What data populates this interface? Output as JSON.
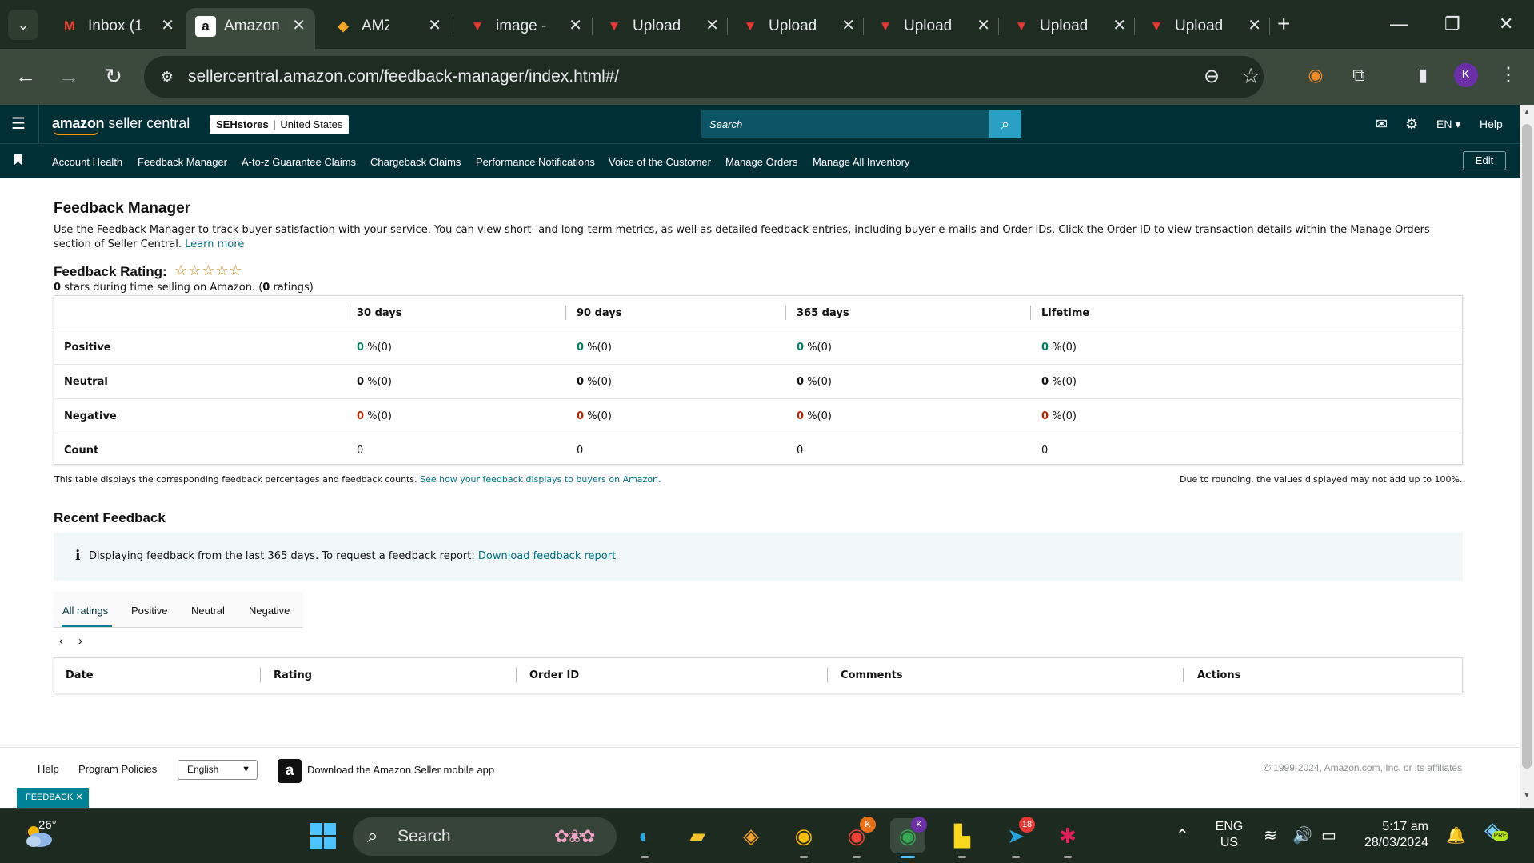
{
  "browser": {
    "tabs": [
      {
        "title": "Inbox (1",
        "icon": "gmail-icon",
        "active": false
      },
      {
        "title": "Amazon",
        "icon": "amazon-icon",
        "active": true
      },
      {
        "title": "AMZ EC",
        "icon": "amz-icon",
        "active": false
      },
      {
        "title": "image -",
        "icon": "upload-icon",
        "active": false
      },
      {
        "title": "Upload",
        "icon": "upload-icon",
        "active": false
      },
      {
        "title": "Upload",
        "icon": "upload-icon",
        "active": false
      },
      {
        "title": "Upload",
        "icon": "upload-icon",
        "active": false
      },
      {
        "title": "Upload",
        "icon": "upload-icon",
        "active": false
      },
      {
        "title": "Upload",
        "icon": "upload-icon",
        "active": false
      }
    ],
    "url": "sellercentral.amazon.com/feedback-manager/index.html#/",
    "profile_initial": "K"
  },
  "header": {
    "logo_brand": "amazon",
    "logo_text": "seller central",
    "store_name": "SEHstores",
    "marketplace": "United States",
    "search_placeholder": "Search",
    "language": "EN",
    "help": "Help"
  },
  "nav": {
    "links": [
      "Account Health",
      "Feedback Manager",
      "A-to-z Guarantee Claims",
      "Chargeback Claims",
      "Performance Notifications",
      "Voice of the Customer",
      "Manage Orders",
      "Manage All Inventory"
    ],
    "edit": "Edit"
  },
  "page": {
    "title": "Feedback Manager",
    "description": "Use the Feedback Manager to track buyer satisfaction with your service. You can view short- and long-term metrics, as well as detailed feedback entries, including buyer e-mails and Order IDs. Click the Order ID to view transaction details within the Manage Orders section of Seller Central.",
    "learn_more": "Learn more",
    "rating_title": "Feedback Rating:",
    "stars": "☆☆☆☆☆",
    "stars_value": 0,
    "rating_stars": "0",
    "rating_sub_a": " stars during time selling on Amazon. (",
    "rating_count": "0",
    "rating_sub_b": " ratings)"
  },
  "feedback_table": {
    "columns": [
      "30 days",
      "90 days",
      "365 days",
      "Lifetime"
    ],
    "rows": [
      {
        "label": "Positive",
        "values": [
          "0",
          "0",
          "0",
          "0"
        ],
        "suffix": "%(0)",
        "color": "#067d62"
      },
      {
        "label": "Neutral",
        "values": [
          "0",
          "0",
          "0",
          "0"
        ],
        "suffix": "%(0)",
        "color": "#111111"
      },
      {
        "label": "Negative",
        "values": [
          "0",
          "0",
          "0",
          "0"
        ],
        "suffix": "%(0)",
        "color": "#b12704"
      },
      {
        "label": "Count",
        "values": [
          "0",
          "0",
          "0",
          "0"
        ],
        "suffix": "",
        "color": "#111111"
      }
    ],
    "note": "This table displays the corresponding feedback percentages and feedback counts.",
    "note_link": "See how your feedback displays to buyers on Amazon.",
    "rounding_note": "Due to rounding, the values displayed may not add up to 100%."
  },
  "recent": {
    "title": "Recent Feedback",
    "info_text": "Displaying feedback from the last 365 days. To request a feedback report:",
    "info_link": "Download feedback report",
    "tabs": [
      "All ratings",
      "Positive",
      "Neutral",
      "Negative"
    ],
    "columns": [
      "Date",
      "Rating",
      "Order ID",
      "Comments",
      "Actions"
    ]
  },
  "footer": {
    "help": "Help",
    "program_policies": "Program Policies",
    "language_selected": "English",
    "app_text": "Download the Amazon Seller mobile app",
    "copyright": "© 1999-2024, Amazon.com, Inc. or its affiliates",
    "feedback_chip": "FEEDBACK ✕"
  },
  "taskbar": {
    "temperature": "26°",
    "search_placeholder": "Search",
    "telegram_badge": "18",
    "chrome_badge_1": "K",
    "chrome_badge_2": "K",
    "lang_line1": "ENG",
    "lang_line2": "US",
    "time": "5:17 am",
    "date": "28/03/2024",
    "copilot_badge": "PRE"
  },
  "colors": {
    "header_bg": "#002f36",
    "link": "#007185",
    "positive": "#067d62",
    "negative": "#b12704",
    "accent": "#008296"
  }
}
